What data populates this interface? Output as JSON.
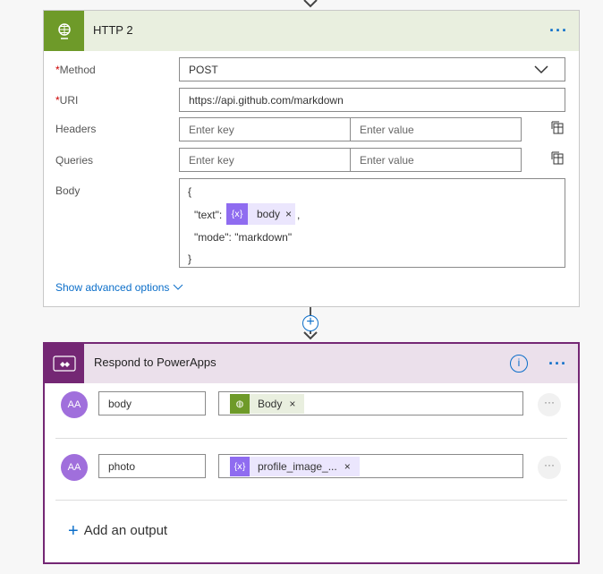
{
  "http_card": {
    "title": "HTTP 2",
    "more": "···",
    "method": {
      "label": "Method",
      "value": "POST"
    },
    "uri": {
      "label": "URI",
      "value": "https://api.github.com/markdown"
    },
    "headers": {
      "label": "Headers",
      "key_placeholder": "Enter key",
      "value_placeholder": "Enter value"
    },
    "queries": {
      "label": "Queries",
      "key_placeholder": "Enter key",
      "value_placeholder": "Enter value"
    },
    "body": {
      "label": "Body",
      "line1": "{",
      "text_key": "\"text\":",
      "token": "body",
      "comma": ",",
      "line3": "\"mode\": \"markdown\"",
      "line4": "}"
    },
    "advanced": "Show advanced options"
  },
  "respond_card": {
    "title": "Respond to PowerApps",
    "more": "···",
    "outputs": [
      {
        "name": "body",
        "token": "Body",
        "avatar": "AA"
      },
      {
        "name": "photo",
        "token": "profile_image_...",
        "avatar": "AA"
      }
    ],
    "add_output": "Add an output"
  },
  "colors": {
    "http": "#6e9a29",
    "powerapps": "#742774",
    "variable": "#8f6cf0",
    "link": "#0b6ec9"
  }
}
